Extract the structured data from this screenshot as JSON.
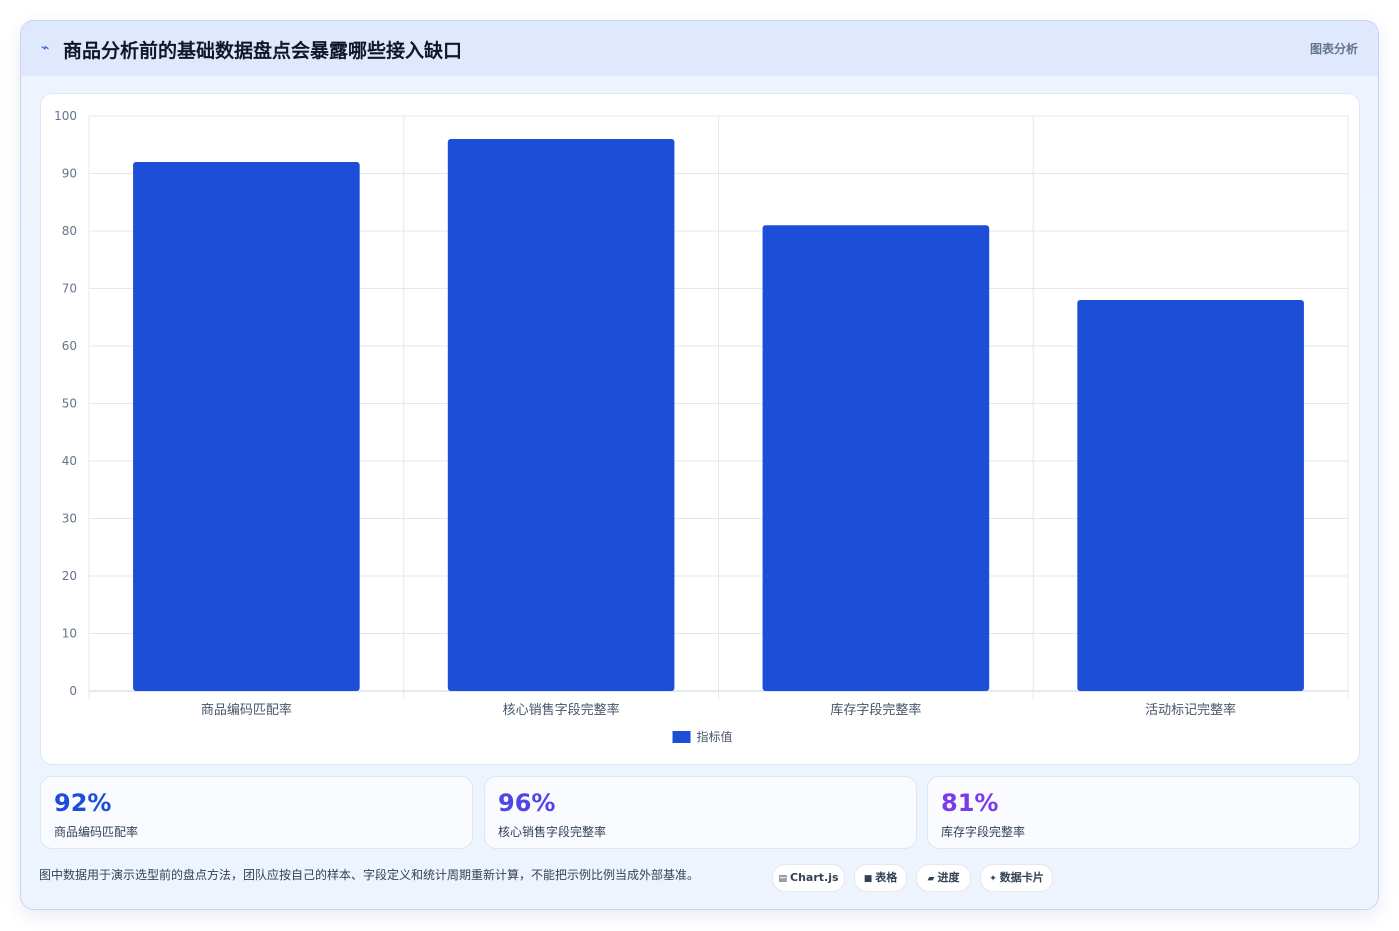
{
  "header": {
    "icon": "trend-line-icon",
    "title": "商品分析前的基础数据盘点会暴露哪些接入缺口",
    "badge": "图表分析"
  },
  "chart_data": {
    "type": "bar",
    "categories": [
      "商品编码匹配率",
      "核心销售字段完整率",
      "库存字段完整率",
      "活动标记完整率"
    ],
    "series": [
      {
        "name": "指标值",
        "values": [
          92,
          96,
          81,
          68
        ],
        "color": "#1d4ed8"
      }
    ],
    "ylim": [
      0,
      100
    ],
    "yticks": [
      0,
      10,
      20,
      30,
      40,
      50,
      60,
      70,
      80,
      90,
      100
    ],
    "grid": true,
    "legend": "bottom"
  },
  "stats": [
    {
      "value": "92%",
      "label": "商品编码匹配率",
      "color": "#1d4ed8"
    },
    {
      "value": "96%",
      "label": "核心销售字段完整率",
      "color": "#4f46e5"
    },
    {
      "value": "81%",
      "label": "库存字段完整率",
      "color": "#7c3aed"
    }
  ],
  "footnote": "图中数据用于演示选型前的盘点方法，团队应按自己的样本、字段定义和统计周期重新计算，不能把示例比例当成外部基准。",
  "pills": [
    {
      "icon": "chart-icon",
      "glyph": "▤",
      "label": "Chart.js"
    },
    {
      "icon": "table-icon",
      "glyph": "■",
      "label": "表格"
    },
    {
      "icon": "progress-icon",
      "glyph": "▰",
      "label": "进度"
    },
    {
      "icon": "sparkle-icon",
      "glyph": "✦",
      "label": "数据卡片"
    }
  ]
}
